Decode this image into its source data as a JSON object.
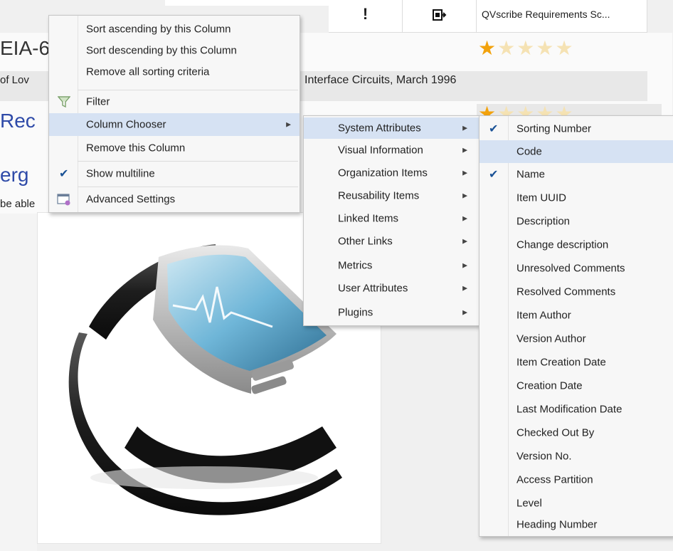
{
  "background_doc": {
    "header": {
      "exclamation": "!",
      "plugin_icon": "plugin-icon",
      "qv_column": "QVscribe Requirements Sc..."
    },
    "text_fragments": {
      "eia": "EIA-6",
      "lov": "of Lov",
      "interface": "Interface Circuits, March 1996",
      "rec": "Rec",
      "erg": "erg",
      "able": "be able"
    },
    "ratings": [
      {
        "filled": 1,
        "total": 5
      },
      {
        "filled": 1,
        "total": 5
      }
    ],
    "colors": {
      "star_on": "#f2a20c",
      "star_off": "#f5e2b3",
      "heading_blue": "#2e4aa8",
      "highlight": "#d6e2f3"
    }
  },
  "context_menu": {
    "items": [
      {
        "label": "Sort ascending by this Column"
      },
      {
        "label": "Sort descending by this Column"
      },
      {
        "label": "Remove all sorting criteria"
      },
      {
        "label": "Filter",
        "icon": "filter-icon"
      },
      {
        "label": "Column Chooser",
        "submenu": true,
        "highlighted": true
      },
      {
        "label": "Remove this Column"
      },
      {
        "label": "Show multiline",
        "checked": true
      },
      {
        "label": "Advanced Settings",
        "icon": "advanced-settings-icon"
      }
    ]
  },
  "column_chooser_menu": {
    "items": [
      {
        "label": "System Attributes",
        "highlighted": true
      },
      {
        "label": "Visual Information"
      },
      {
        "label": "Organization Items"
      },
      {
        "label": "Reusability Items"
      },
      {
        "label": "Linked Items"
      },
      {
        "label": "Other Links"
      },
      {
        "label": "Metrics"
      },
      {
        "label": "User Attributes"
      },
      {
        "label": "Plugins"
      }
    ]
  },
  "system_attributes_menu": {
    "items": [
      {
        "label": "Sorting Number",
        "checked": true
      },
      {
        "label": "Code",
        "highlighted": true
      },
      {
        "label": "Name",
        "checked": true
      },
      {
        "label": "Item UUID"
      },
      {
        "label": "Description"
      },
      {
        "label": "Change description"
      },
      {
        "label": "Unresolved Comments"
      },
      {
        "label": "Resolved Comments"
      },
      {
        "label": "Item Author"
      },
      {
        "label": "Version Author"
      },
      {
        "label": "Item Creation Date"
      },
      {
        "label": "Creation Date"
      },
      {
        "label": "Last Modification Date"
      },
      {
        "label": "Checked Out By"
      },
      {
        "label": "Version No."
      },
      {
        "label": "Access Partition"
      },
      {
        "label": "Level"
      },
      {
        "label": "Heading Number"
      }
    ]
  }
}
